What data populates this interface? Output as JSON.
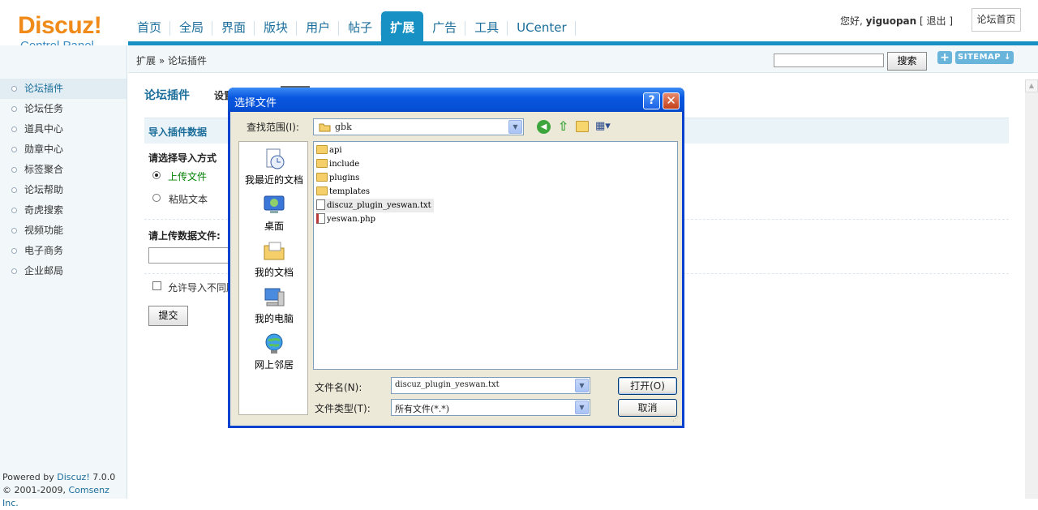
{
  "header": {
    "logo_main": "Discuz!",
    "logo_sub": "Control Panel",
    "nav": [
      "首页",
      "全局",
      "界面",
      "版块",
      "用户",
      "帖子",
      "扩展",
      "广告",
      "工具",
      "UCenter"
    ],
    "active_nav": "扩展",
    "greeting": "您好,",
    "username": "yiguopan",
    "logout": "[ 退出 ]",
    "home_button": "论坛首页"
  },
  "crumbbar": {
    "breadcrumb": "扩展 » 论坛插件",
    "search_button": "搜索",
    "plus_button": "+",
    "sitemap_button": "SITEMAP ↓"
  },
  "sidebar": {
    "items": [
      "论坛插件",
      "论坛任务",
      "道具中心",
      "勋章中心",
      "标签聚合",
      "论坛帮助",
      "奇虎搜索",
      "视频功能",
      "电子商务",
      "企业邮局"
    ],
    "active": "论坛插件",
    "powered_prefix": "Powered by ",
    "powered_link": "Discuz!",
    "powered_version": " 7.0.0",
    "copyright_prefix": "© 2001-2009, ",
    "copyright_link": "Comsenz Inc."
  },
  "main": {
    "page_title": "论坛插件",
    "tab_settings": "设置",
    "section_title": "导入插件数据",
    "method_label": "请选择导入方式",
    "radio_upload": "上传文件",
    "radio_paste": "粘贴文本",
    "upload_label": "请上传数据文件:",
    "allow_label": "允许导入不同版本",
    "submit": "提交"
  },
  "dialog": {
    "title": "选择文件",
    "help": "?",
    "close": "✕",
    "look_in_label": "查找范围(I):",
    "look_in_value": "gbk",
    "places": [
      "我最近的文档",
      "桌面",
      "我的文档",
      "我的电脑",
      "网上邻居"
    ],
    "files": [
      {
        "name": "api",
        "type": "folder"
      },
      {
        "name": "include",
        "type": "folder"
      },
      {
        "name": "plugins",
        "type": "folder"
      },
      {
        "name": "templates",
        "type": "folder"
      },
      {
        "name": "discuz_plugin_yeswan.txt",
        "type": "txt"
      },
      {
        "name": "yeswan.php",
        "type": "php"
      }
    ],
    "selected_file": "discuz_plugin_yeswan.txt",
    "filename_label": "文件名(N):",
    "filename_value": "discuz_plugin_yeswan.txt",
    "filetype_label": "文件类型(T):",
    "filetype_value": "所有文件(*.*)",
    "open_button": "打开(O)",
    "cancel_button": "取消"
  }
}
